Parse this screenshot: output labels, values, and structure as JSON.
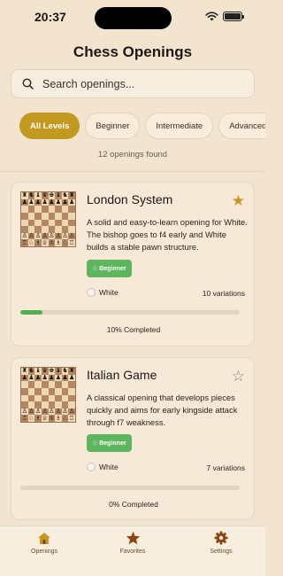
{
  "status": {
    "time": "20:37"
  },
  "title": "Chess Openings",
  "search": {
    "placeholder": "Search openings...",
    "value": ""
  },
  "filters": [
    {
      "label": "All Levels",
      "active": true
    },
    {
      "label": "Beginner",
      "active": false
    },
    {
      "label": "Intermediate",
      "active": false
    },
    {
      "label": "Advanced",
      "active": false
    }
  ],
  "count_text": "12 openings found",
  "openings": [
    {
      "name": "London System",
      "favorite": true,
      "description": "A solid and easy-to-learn opening for White. The bishop goes to f4 early and White builds a stable pawn structure.",
      "level": "☆ Beginner",
      "color": "White",
      "variations": "10 variations",
      "progress": 0.1,
      "progress_label": "10% Completed"
    },
    {
      "name": "Italian Game",
      "favorite": false,
      "description": "A classical opening that develops pieces quickly and aims for early kingside attack through f7 weakness.",
      "level": "☆ Beginner",
      "color": "White",
      "variations": "7 variations",
      "progress": 0.0,
      "progress_label": "0% Completed"
    }
  ],
  "tabs": [
    {
      "label": "Openings",
      "icon": "home-icon"
    },
    {
      "label": "Favorites",
      "icon": "star-icon"
    },
    {
      "label": "Settings",
      "icon": "gear-icon"
    }
  ],
  "colors": {
    "accent": "#c39a1f",
    "background": "#f2e4cf",
    "beginner_badge": "#5db65d",
    "progress": "#4fb04f",
    "tab_icon": "#8b4513"
  }
}
